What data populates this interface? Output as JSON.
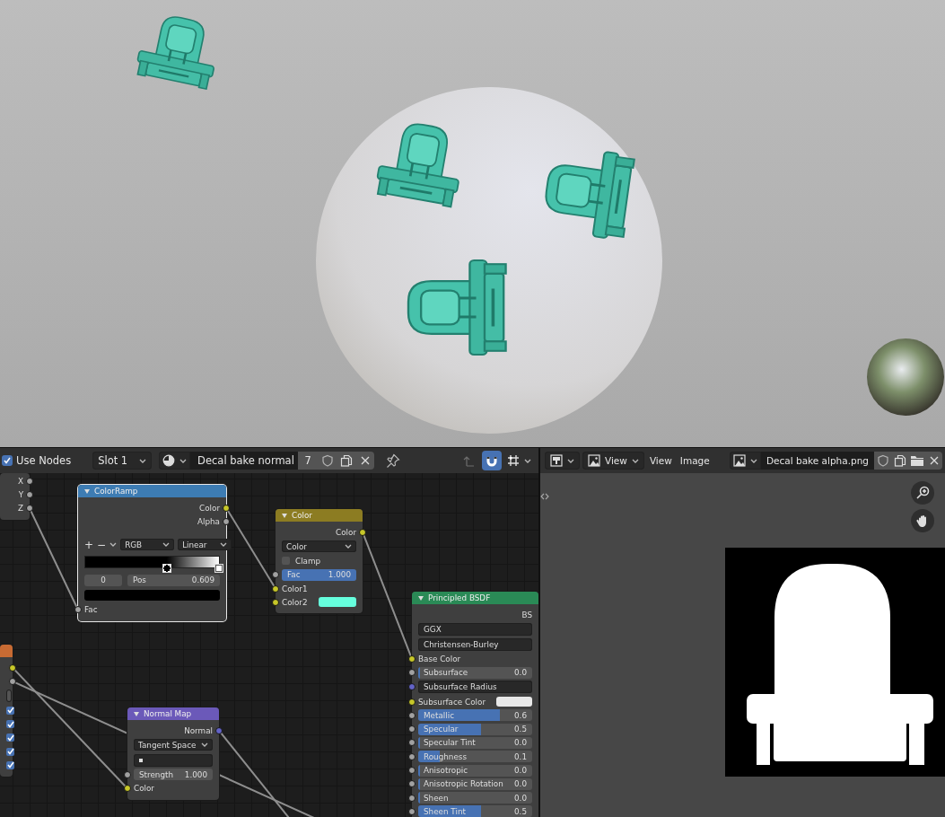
{
  "shader_editor": {
    "header": {
      "use_nodes": {
        "label": "Use Nodes",
        "checked": true
      },
      "slot": "Slot 1",
      "material": "Decal bake normal",
      "users": "7",
      "parent_disabled": true,
      "snap_on": true
    },
    "nodes": [
      {
        "selected": false,
        "rows": [
          {
            "kind": "output",
            "label": "X",
            "socket": {
              "kind": "float"
            }
          },
          {
            "kind": "output",
            "label": "Y",
            "socket": {
              "kind": "float"
            }
          },
          {
            "kind": "output",
            "label": "Z",
            "socket": {
              "kind": "float"
            }
          }
        ]
      },
      {
        "title": "ColorRamp",
        "color": "#3d7cb3",
        "selected": true,
        "rows": [
          {
            "kind": "output",
            "label": "Color",
            "socket": {
              "kind": "color"
            }
          },
          {
            "kind": "output",
            "label": "Alpha",
            "socket": {
              "kind": "float"
            }
          },
          {
            "kind": "ramp-tools",
            "buttons": [
              "+",
              "−"
            ],
            "color_mode": "RGB",
            "interpolation": "Linear"
          },
          {
            "kind": "ramp",
            "stops": [
              {
                "level": 0.609,
                "color": "#000000",
                "selected": true
              },
              {
                "level": 1,
                "color": "#ffffff",
                "selected": false
              }
            ]
          },
          {
            "kind": "ramp-fields",
            "index": "0",
            "label": "Pos",
            "value": "0.609"
          },
          {
            "kind": "swatch",
            "color": "#000000"
          },
          {
            "kind": "input",
            "label": "Fac",
            "socket": {
              "kind": "float"
            }
          }
        ]
      },
      {
        "title": "Color",
        "color": "#8c7c22",
        "selected": false,
        "rows": [
          {
            "kind": "output",
            "label": "Color",
            "socket": {
              "kind": "color"
            }
          },
          {
            "kind": "dropdown",
            "label": "Color"
          },
          {
            "kind": "checkbox",
            "label": "Clamp",
            "checked": false
          },
          {
            "kind": "slider",
            "label": "Fac",
            "value": "1.000",
            "level": 1,
            "socket": {
              "kind": "float"
            }
          },
          {
            "kind": "input",
            "label": "Color1",
            "socket": {
              "kind": "color"
            }
          },
          {
            "kind": "input",
            "label": "Color2",
            "socket": {
              "kind": "color"
            },
            "color": "#66ffdd"
          }
        ]
      },
      {
        "color": "#c86b33",
        "selected": false,
        "rows": [
          {
            "kind": "output",
            "socket": {
              "kind": "color"
            }
          },
          {
            "kind": "output",
            "socket": {
              "kind": "float"
            }
          },
          {
            "kind": "field"
          },
          {
            "kind": "checkbox",
            "checked": true
          },
          {
            "kind": "checkbox",
            "checked": true
          },
          {
            "kind": "checkbox",
            "checked": true
          },
          {
            "kind": "checkbox",
            "checked": true
          },
          {
            "kind": "checkbox",
            "checked": true
          }
        ]
      },
      {
        "title": "Normal Map",
        "color": "#6b59b9",
        "selected": false,
        "rows": [
          {
            "kind": "output",
            "label": "Normal",
            "socket": {
              "kind": "vector"
            }
          },
          {
            "kind": "dropdown",
            "label": "Tangent Space"
          },
          {
            "kind": "uv-field"
          },
          {
            "kind": "number",
            "label": "Strength",
            "value": "1.000",
            "socket": {
              "kind": "float"
            }
          },
          {
            "kind": "input",
            "label": "Color",
            "socket": {
              "kind": "color"
            }
          }
        ]
      },
      {
        "title": "Principled BSDF",
        "color": "#2a8a56",
        "selected": false,
        "rows": [
          {
            "kind": "output",
            "label": "BS"
          },
          {
            "kind": "field",
            "label": "GGX"
          },
          {
            "kind": "field",
            "label": "Christensen-Burley"
          },
          {
            "kind": "input",
            "label": "Base Color",
            "socket": {
              "kind": "color"
            }
          },
          {
            "kind": "slider",
            "label": "Subsurface",
            "value": "0.0",
            "level": 0,
            "socket": {
              "kind": "float"
            }
          },
          {
            "kind": "field",
            "label": "Subsurface Radius",
            "socket": {
              "kind": "vector"
            }
          },
          {
            "kind": "input",
            "label": "Subsurface Color",
            "socket": {
              "kind": "color"
            },
            "color": "#e8e8e8"
          },
          {
            "kind": "slider",
            "label": "Metallic",
            "value": "0.6",
            "level": 0.72,
            "socket": {
              "kind": "float"
            }
          },
          {
            "kind": "slider",
            "label": "Specular",
            "value": "0.5",
            "level": 0.55,
            "socket": {
              "kind": "float"
            }
          },
          {
            "kind": "slider",
            "label": "Specular Tint",
            "value": "0.0",
            "level": 0,
            "socket": {
              "kind": "float"
            }
          },
          {
            "kind": "slider",
            "label": "Roughness",
            "value": "0.1",
            "level": 0.19,
            "socket": {
              "kind": "float"
            }
          },
          {
            "kind": "slider",
            "label": "Anisotropic",
            "value": "0.0",
            "level": 0,
            "socket": {
              "kind": "float"
            }
          },
          {
            "kind": "slider",
            "label": "Anisotropic Rotation",
            "value": "0.0",
            "level": 0,
            "socket": {
              "kind": "float"
            }
          },
          {
            "kind": "slider",
            "label": "Sheen",
            "value": "0.0",
            "level": 0,
            "socket": {
              "kind": "float"
            }
          },
          {
            "kind": "slider",
            "label": "Sheen Tint",
            "value": "0.5",
            "level": 0.55,
            "socket": {
              "kind": "float"
            }
          }
        ]
      }
    ]
  },
  "image_editor": {
    "header": {
      "mode": "View",
      "menus": [
        "View",
        "Image"
      ],
      "image": "Decal bake alpha.png"
    }
  }
}
